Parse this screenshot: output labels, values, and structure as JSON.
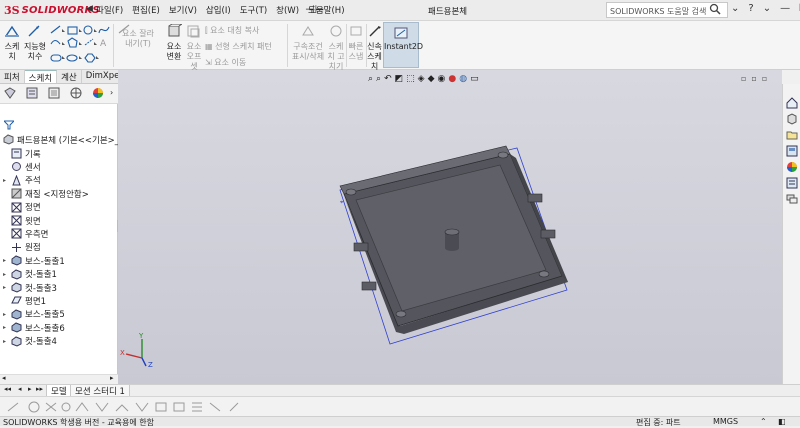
{
  "app": {
    "logo_ds": "3S",
    "logo_brand": "SOLIDWORKS",
    "document_title": "패드용본체"
  },
  "menu": {
    "items": [
      {
        "label": "파일(F)"
      },
      {
        "label": "편집(E)"
      },
      {
        "label": "보기(V)"
      },
      {
        "label": "삽입(I)"
      },
      {
        "label": "도구(T)"
      },
      {
        "label": "창(W)"
      },
      {
        "label": "도움말(H)"
      }
    ]
  },
  "search": {
    "placeholder": "SOLIDWORKS 도움말 검색"
  },
  "toolbar": {
    "sketch": "스케\n치",
    "smart_dim": "지능형\n치수",
    "trim": "요소 잘라\n내기(T)",
    "convert": "요소\n변환",
    "offset": "요소\n오프\n셋",
    "mirror": "요소 대칭 복사",
    "linear_pattern": "선형 스케치 패턴",
    "move": "요소 이동",
    "relations": "구속조건\n표시/삭제",
    "repair": "스케\n치 고\n치기",
    "quick_snaps": "빠른\n스냅",
    "rapid_sketch": "신속\n스케\n치",
    "instant2d": "Instant2D"
  },
  "panel_tabs": [
    "피처",
    "스케치",
    "계산",
    "DimXpert"
  ],
  "tree": {
    "root": "패드용본체 (기본<<기본>_표",
    "items": [
      {
        "label": "기록",
        "exp": ""
      },
      {
        "label": "센서",
        "exp": ""
      },
      {
        "label": "주석",
        "exp": "▸"
      },
      {
        "label": "재질 <지정안함>",
        "exp": ""
      },
      {
        "label": "정면",
        "exp": ""
      },
      {
        "label": "윗면",
        "exp": ""
      },
      {
        "label": "우측면",
        "exp": ""
      },
      {
        "label": "원점",
        "exp": ""
      },
      {
        "label": "보스-돌출1",
        "exp": "▸"
      },
      {
        "label": "컷-돌출1",
        "exp": "▸"
      },
      {
        "label": "컷-돌출3",
        "exp": "▸"
      },
      {
        "label": "평면1",
        "exp": ""
      },
      {
        "label": "보스-돌출5",
        "exp": "▸"
      },
      {
        "label": "보스-돌출6",
        "exp": "▸"
      },
      {
        "label": "컷-돌출4",
        "exp": "▸"
      }
    ]
  },
  "bottom_tabs": [
    "모델",
    "모션 스터디 1"
  ],
  "triad": {
    "y": "Y",
    "x": "X",
    "z": "Z"
  },
  "status": {
    "left": "SOLIDWORKS 학생용 버전 - 교육용에 한함",
    "mode": "편집 중: 파트",
    "units": "MMGS"
  }
}
